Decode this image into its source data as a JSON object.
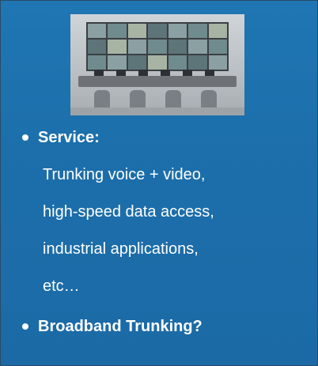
{
  "photo": {
    "icon": "control-room-photo"
  },
  "bullets": [
    {
      "label": "Service:"
    },
    {
      "label": "Broadband Trunking?"
    }
  ],
  "service_lines": [
    "Trunking voice + video,",
    "high-speed data access,",
    "industrial applications,",
    "etc…"
  ],
  "colors": {
    "background": "#1c6fab",
    "text": "#ffffff"
  }
}
